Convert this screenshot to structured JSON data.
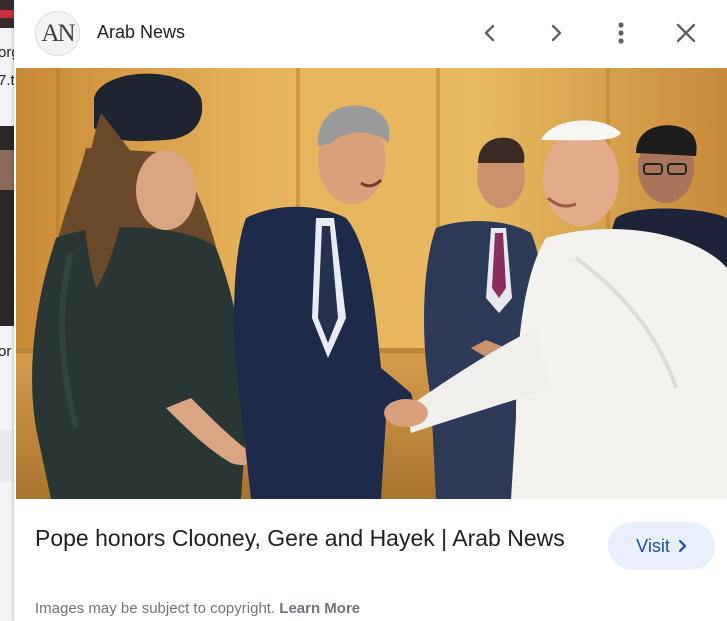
{
  "background": {
    "snippets": [
      "org",
      "7.t",
      "or"
    ]
  },
  "panel": {
    "source": {
      "logo_text": "AN",
      "name": "Arab News"
    },
    "toolbar": {
      "prev_icon": "chevron-left-icon",
      "next_icon": "chevron-right-icon",
      "more_icon": "more-vert-icon",
      "close_icon": "close-icon"
    },
    "image": {
      "alt": "Pope honors Clooney, Gere and Hayek | Arab News"
    },
    "title": "Pope honors Clooney, Gere and Hayek | Arab News",
    "visit_button": {
      "label": "Visit",
      "icon": "chevron-right-icon"
    },
    "footer": {
      "notice": "Images may be subject to copyright.",
      "link": "Learn More"
    }
  },
  "colors": {
    "accent": "#174ea6",
    "visit_bg": "#e8f0fe",
    "muted_text": "#70757a"
  }
}
